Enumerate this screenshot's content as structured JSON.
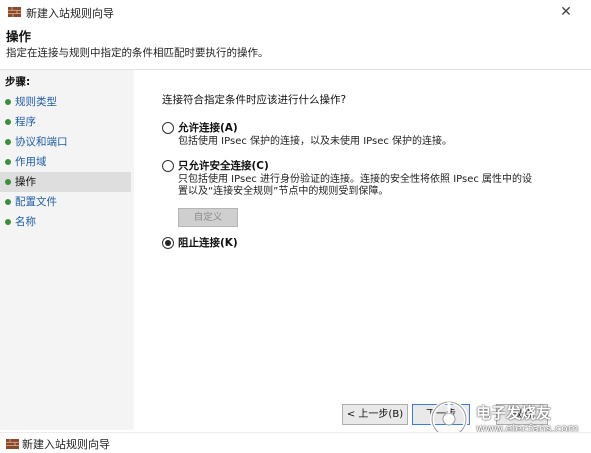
{
  "window": {
    "title": "新建入站规则向导",
    "close_glyph": "✕",
    "icon": "firewall-icon"
  },
  "header": {
    "title": "操作",
    "description": "指定在连接与规则中指定的条件相匹配时要执行的操作。"
  },
  "steps": {
    "heading": "步骤:",
    "items": [
      {
        "label": "规则类型"
      },
      {
        "label": "程序"
      },
      {
        "label": "协议和端口"
      },
      {
        "label": "作用域"
      },
      {
        "label": "操作",
        "current": true
      },
      {
        "label": "配置文件"
      },
      {
        "label": "名称"
      }
    ],
    "bullet_color": "#3e8f3a",
    "link_color": "#1f5fa8"
  },
  "main": {
    "question": "连接符合指定条件时应该进行什么操作?",
    "options": {
      "allow": {
        "label": "允许连接(A)",
        "description": "包括使用 IPsec 保护的连接，以及未使用 IPsec 保护的连接。",
        "checked": false
      },
      "secure": {
        "label": "只允许安全连接(C)",
        "description_line1": "只包括使用 IPsec 进行身份验证的连接。连接的安全性将依照 IPsec 属性中的设",
        "description_line2": "置以及“连接安全规则”节点中的规则受到保障。",
        "checked": false
      },
      "block": {
        "label": "阻止连接(K)",
        "checked": true
      }
    },
    "customize_label": "自定义"
  },
  "buttons": {
    "back": "< 上一步(B)",
    "next": "下一步",
    "cancel": "取消"
  },
  "watermark": {
    "cn": "电子发烧友",
    "url": "www.elecfans.com"
  },
  "bottom": {
    "title": "新建入站规则向导"
  }
}
